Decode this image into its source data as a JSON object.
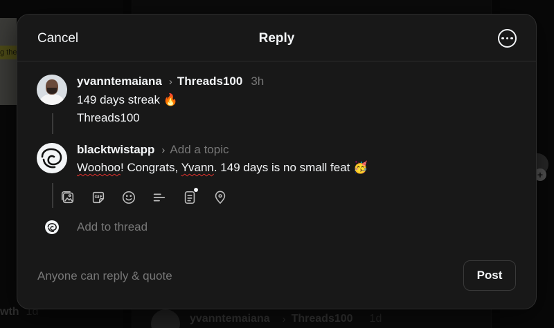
{
  "background": {
    "left_snippet": "g the",
    "left_bottom_text": "wth",
    "left_bottom_time": "1d",
    "bottom_post": {
      "handle": "yvanntemaiana",
      "topic": "Threads100",
      "time": "1d"
    }
  },
  "modal": {
    "cancel_label": "Cancel",
    "title": "Reply",
    "more_icon": "more-icon"
  },
  "original_post": {
    "handle": "yvanntemaiana",
    "topic": "Threads100",
    "time": "3h",
    "line1": "149 days streak 🔥",
    "line2": "Threads100"
  },
  "reply": {
    "handle": "blacktwistapp",
    "topic_placeholder": "Add a topic",
    "text_misspelled": "Woohoo",
    "text_rest_1": "! Congrats, ",
    "text_misspelled_2": "Yvann",
    "text_rest_2": ". 149 days is no small feat 🥳",
    "toolbar_icons": [
      "image-icon",
      "gif-icon",
      "emoji-icon",
      "poll-icon",
      "document-icon",
      "location-icon"
    ]
  },
  "add_thread": {
    "placeholder": "Add to thread"
  },
  "footer": {
    "reply_permission": "Anyone can reply & quote",
    "post_label": "Post"
  }
}
